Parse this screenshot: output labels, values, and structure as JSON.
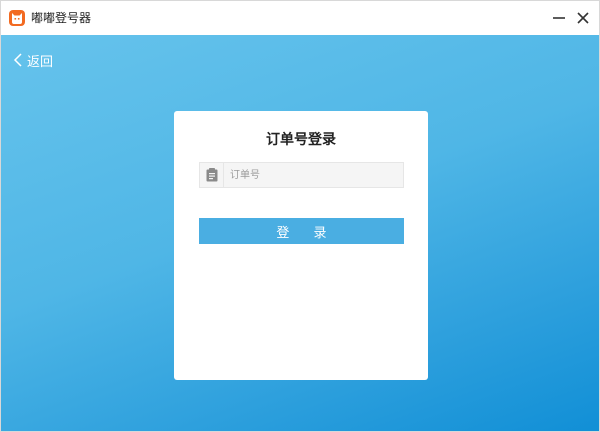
{
  "titlebar": {
    "app_title": "嘟嘟登号器",
    "app_icon": "app-logo-icon",
    "minimize_icon": "minimize-icon",
    "close_icon": "close-icon"
  },
  "nav": {
    "back_label": "返回",
    "back_icon": "chevron-left-icon"
  },
  "login_card": {
    "title": "订单号登录",
    "order_input": {
      "placeholder": "订单号",
      "value": "",
      "icon": "clipboard-icon"
    },
    "login_button_label": "登 录"
  },
  "colors": {
    "background_top": "#66c3ec",
    "background_bottom": "#118fd6",
    "button": "#4aaee2",
    "app_icon": "#f26a21"
  }
}
